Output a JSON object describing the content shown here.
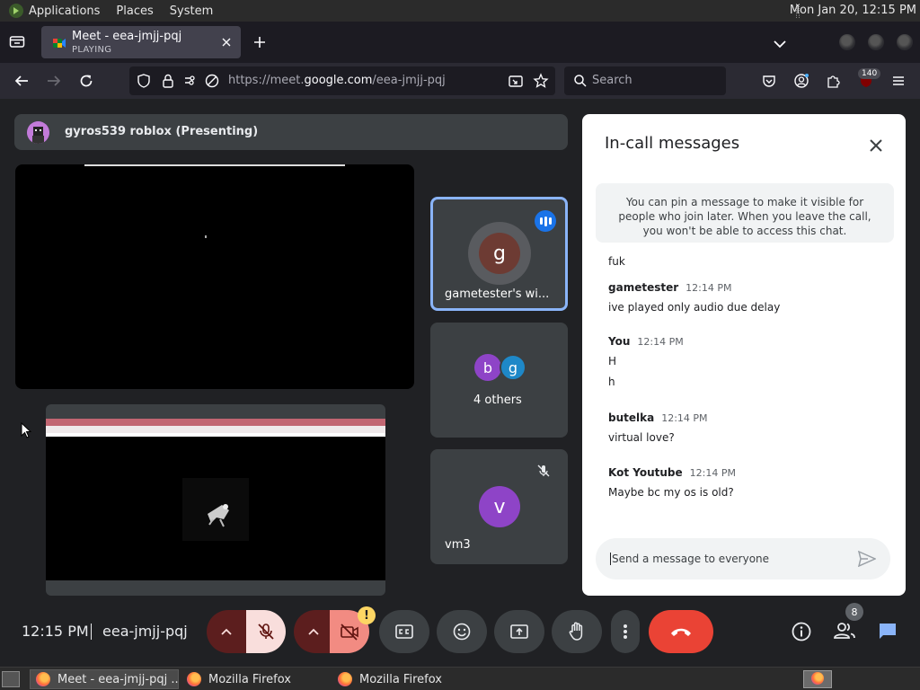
{
  "gnome_panel": {
    "menus": [
      "Applications",
      "Places",
      "System"
    ],
    "clock": "Mon Jan 20, 12:15 PM"
  },
  "browser": {
    "tab": {
      "title": "Meet - eea-jmjj-pqj",
      "subtitle": "PLAYING"
    },
    "url": {
      "prefix": "https://meet.",
      "host": "google.com",
      "path": "/eea-jmjj-pqj"
    },
    "search_placeholder": "Search",
    "extension_badge": "140"
  },
  "meet": {
    "presenting_label": "gyros539 roblox (Presenting)",
    "participants": [
      {
        "name": "gametester's wi...",
        "initial": "g",
        "color": "#6d3b33"
      },
      {
        "name": "4 others",
        "initials": [
          "b",
          "g"
        ],
        "colors": [
          "#8e44c7",
          "#1e88c8"
        ]
      },
      {
        "name": "vm3",
        "initial": "v",
        "color": "#8e44c7"
      }
    ],
    "time": "12:15 PM",
    "meeting_code": "eea-jmjj-pqj",
    "people_count": "8",
    "warning_mark": "!"
  },
  "chat": {
    "title": "In-call messages",
    "pin_notice": "You can pin a message to make it visible for people who join later. When you leave the call, you won't be able to access this chat.",
    "partial_message": "fuk",
    "messages": [
      {
        "sender": "gametester",
        "time": "12:14 PM",
        "lines": [
          "ive played only audio due delay"
        ]
      },
      {
        "sender": "You",
        "time": "12:14 PM",
        "lines": [
          "H",
          "h"
        ]
      },
      {
        "sender": "butelka",
        "time": "12:14 PM",
        "lines": [
          "virtual love?"
        ]
      },
      {
        "sender": "Kot Youtube",
        "time": "12:14 PM",
        "lines": [
          "Maybe bc my os is old?"
        ]
      }
    ],
    "input_placeholder": "Send a message to everyone"
  },
  "taskbar": {
    "items": [
      "Meet - eea-jmjj-pqj ...",
      "Mozilla Firefox",
      "Mozilla Firefox"
    ]
  }
}
